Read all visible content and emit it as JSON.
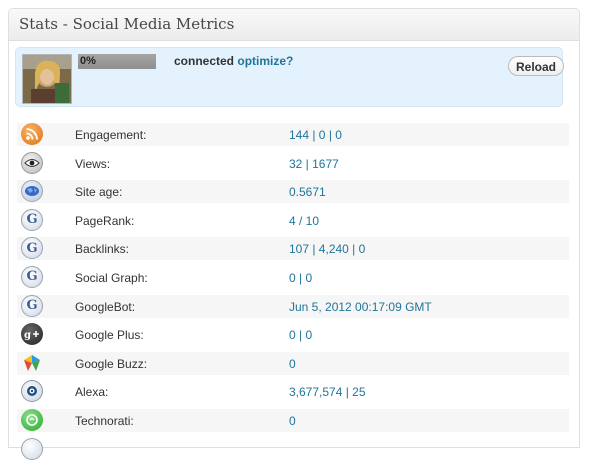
{
  "widget": {
    "title": "Stats - Social Media Metrics"
  },
  "connect": {
    "progress_label": "0%",
    "progress_value": 0,
    "status_text": "connected",
    "optimize_link": "optimize?",
    "reload_label": "Reload"
  },
  "metrics": [
    {
      "icon": "rss-icon",
      "label": "Engagement:",
      "value": "144 | 0 | 0"
    },
    {
      "icon": "eye-icon",
      "label": "Views:",
      "value": "32 | 1677"
    },
    {
      "icon": "globe-icon",
      "label": "Site age:",
      "value": "0.5671"
    },
    {
      "icon": "google-icon",
      "label": "PageRank:",
      "value": "4 / 10"
    },
    {
      "icon": "google-icon",
      "label": "Backlinks:",
      "value": "107 | 4,240 | 0"
    },
    {
      "icon": "google-icon",
      "label": "Social Graph:",
      "value": "0 | 0"
    },
    {
      "icon": "google-icon",
      "label": "GoogleBot:",
      "value": "Jun 5, 2012 00:17:09 GMT"
    },
    {
      "icon": "google-plus-icon",
      "label": "Google Plus:",
      "value": "0 | 0"
    },
    {
      "icon": "google-buzz-icon",
      "label": "Google Buzz:",
      "value": "0"
    },
    {
      "icon": "alexa-icon",
      "label": "Alexa:",
      "value": "3,677,574 | 25"
    },
    {
      "icon": "technorati-icon",
      "label": "Technorati:",
      "value": "0"
    }
  ],
  "colors": {
    "link": "#21759b",
    "connect_bg": "#e4f2fd"
  }
}
